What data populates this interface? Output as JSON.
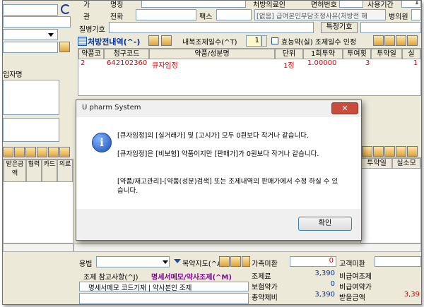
{
  "header": {
    "row1": {
      "tab1": "가",
      "label_name": "명칭",
      "label_hospital": "처방의료인",
      "label_license": "면허번호",
      "label_period": "사용기간",
      "period_value": "1"
    },
    "row2": {
      "tab2": "관",
      "label_phone": "전화",
      "label_fax": "팩스",
      "exemption_text": "[없음] 급여본인부담조정사유(처방전 해",
      "label_clinic": "병의원"
    },
    "row3": {
      "label_disease": "질병기호",
      "special_button": "특정기호"
    }
  },
  "left_panel": {
    "payer_label": "입자명",
    "stock_col_labels": [
      "받은금액",
      "협력",
      "카드",
      "의료"
    ]
  },
  "prescription": {
    "title": "처방전내역(^-)",
    "days_label": "내복조제일수(^T)",
    "days_value": "1",
    "efficacy_checkbox": "효능약(실) 조제일수 인정",
    "columns": [
      "약품코",
      "청구코드",
      "약품/성분명",
      "단위",
      "1회투약",
      "투여횟",
      "투약일",
      "실"
    ],
    "rows": [
      {
        "no": "2",
        "code": "642102360",
        "name": "큐자임정",
        "unit": "1정",
        "dose": "1.00000",
        "times": "3",
        "days": "1"
      }
    ]
  },
  "lower_right": {
    "col_days": "투약일",
    "col_real": "실소모"
  },
  "dialog": {
    "title": "U pharm System",
    "close": "✕",
    "icon": "info-icon",
    "lines": [
      "[큐자임정]의 [실거래가] 및 [고시가] 모두 0원보다 작거나 같습니다.",
      "[큐자임정]은 [비보험] 약품이지만 [판매가]가 0원보다 작거나 같습니다.",
      "[약품/재고관리]-[약품(성분)검색] 또는 조제내역의 판매가에서 수정 하실 수 있습니다."
    ],
    "ok_button": "확인"
  },
  "bottom": {
    "usage_label": "용법",
    "dosing_label": "복약지도(^A)",
    "ref_label": "조제 참고사항(^J)",
    "statement_label": "명세서메모/약사조제(^M)",
    "memo_label": "명세서메모 코드기재 | 약사본인 조제",
    "totals": [
      {
        "label": "가족미환",
        "value": "0"
      },
      {
        "label": "조제료",
        "value": "3,390"
      },
      {
        "label": "보험약가",
        "value": "0"
      },
      {
        "label": "총약제비",
        "value": "3,390"
      }
    ],
    "totals_right": [
      {
        "label": "고객미환",
        "value": ""
      },
      {
        "label": "비급여조제",
        "value": ""
      },
      {
        "label": "비급여약가",
        "value": ""
      },
      {
        "label": "받을금액",
        "value": "3,39"
      }
    ]
  },
  "colors": {
    "accent": "#0030a0",
    "alert": "#e00000",
    "highlight": "#8a00a8"
  }
}
